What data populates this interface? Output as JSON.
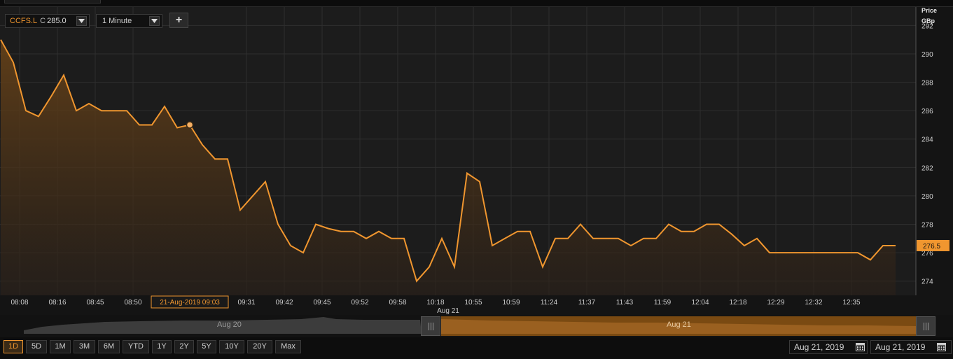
{
  "header": {
    "symbol": "CCFS.L",
    "last_label": "C",
    "last_value": "285.0",
    "interval": "1 Minute",
    "add_label": "+"
  },
  "chart_data": {
    "type": "area",
    "series": [
      {
        "color": "#f0962f",
        "values": [
          291.0,
          289.4,
          286.0,
          285.6,
          287.0,
          288.5,
          286.0,
          286.5,
          286.0,
          286.0,
          286.0,
          285.0,
          285.0,
          286.3,
          284.8,
          285.0,
          283.6,
          282.6,
          282.6,
          279.0,
          280.0,
          281.0,
          278.0,
          276.5,
          276.0,
          278.0,
          277.7,
          277.5,
          277.5,
          277.0,
          277.5,
          277.0,
          277.0,
          274.0,
          275.0,
          277.0,
          275.0,
          281.6,
          281.0,
          276.5,
          277.0,
          277.5,
          277.5,
          275.0,
          277.0,
          277.0,
          278.0,
          277.0,
          277.0,
          277.0,
          276.5,
          277.0,
          277.0,
          278.0,
          277.5,
          277.5,
          278.0,
          278.0,
          277.3,
          276.5,
          277.0,
          276.0,
          276.0,
          276.0,
          276.0,
          276.0,
          276.0,
          276.0,
          276.0,
          275.5,
          276.5,
          276.5
        ]
      }
    ],
    "hover_index": 15,
    "x_ticks": [
      {
        "i": 1.5,
        "label": "08:08"
      },
      {
        "i": 4.5,
        "label": "08:16"
      },
      {
        "i": 7.5,
        "label": "08:45"
      },
      {
        "i": 10.5,
        "label": "08:50"
      },
      {
        "i": 19.5,
        "label": "09:31"
      },
      {
        "i": 22.5,
        "label": "09:42"
      },
      {
        "i": 25.5,
        "label": "09:45"
      },
      {
        "i": 28.5,
        "label": "09:52"
      },
      {
        "i": 31.5,
        "label": "09:58"
      },
      {
        "i": 34.5,
        "label": "10:18"
      },
      {
        "i": 37.5,
        "label": "10:55"
      },
      {
        "i": 40.5,
        "label": "10:59"
      },
      {
        "i": 43.5,
        "label": "11:24"
      },
      {
        "i": 46.5,
        "label": "11:37"
      },
      {
        "i": 49.5,
        "label": "11:43"
      },
      {
        "i": 52.5,
        "label": "11:59"
      },
      {
        "i": 55.5,
        "label": "12:04"
      },
      {
        "i": 58.5,
        "label": "12:18"
      },
      {
        "i": 61.5,
        "label": "12:29"
      },
      {
        "i": 64.5,
        "label": "12:32"
      },
      {
        "i": 67.5,
        "label": "12:35"
      }
    ],
    "day_label": {
      "i": 35.5,
      "label": "Aug 21"
    },
    "crosshair_label": "21-Aug-2019 09:03",
    "y_ticks": [
      274,
      276,
      278,
      280,
      282,
      284,
      286,
      288,
      290,
      292
    ],
    "ylim": [
      273.0,
      293.3
    ],
    "ylabel_line1": "Price",
    "ylabel_line2": "GBp",
    "last_price_label": "276.5",
    "grid": true
  },
  "navigator": {
    "left_label": "Aug 20",
    "right_label": "Aug 21"
  },
  "ranges": [
    {
      "label": "1D",
      "active": true
    },
    {
      "label": "5D"
    },
    {
      "label": "1M"
    },
    {
      "label": "3M"
    },
    {
      "label": "6M"
    },
    {
      "label": "YTD"
    },
    {
      "label": "1Y"
    },
    {
      "label": "2Y"
    },
    {
      "label": "5Y"
    },
    {
      "label": "10Y"
    },
    {
      "label": "20Y"
    },
    {
      "label": "Max"
    }
  ],
  "dates": {
    "from": "Aug 21, 2019",
    "to": "Aug 21, 2019"
  },
  "icons": {
    "calendar": "calendar-icon",
    "dropdown": "chevron-down-icon",
    "handle": "grip-handle-icon"
  }
}
